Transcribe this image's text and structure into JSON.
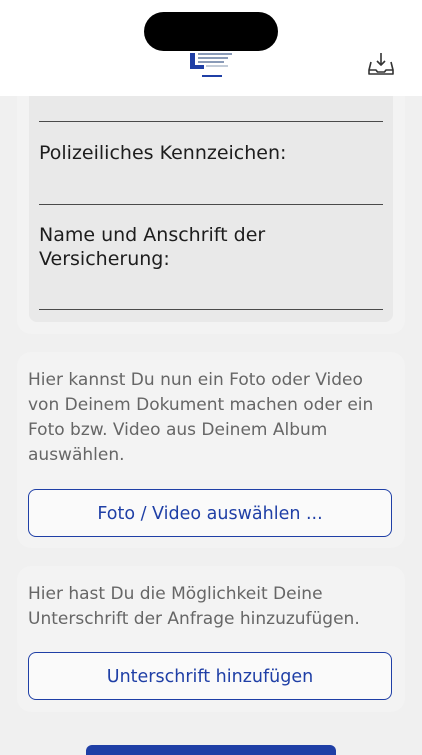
{
  "header": {
    "logo_icon": "company-logo",
    "inbox_icon": "inbox-download-icon"
  },
  "form": {
    "plate_label": "Polizeiliches Kennzeichen:",
    "insurance_label": "Name und Anschrift der Versicherung:"
  },
  "media": {
    "description": "Hier kannst Du nun ein Foto oder Video von Deinem Dokument machen oder ein Foto bzw. Video aus Deinem Album auswählen.",
    "button_label": "Foto / Video auswählen ..."
  },
  "signature": {
    "description": "Hier hast Du die Möglichkeit Deine Unterschrift der Anfrage hinzuzufügen.",
    "button_label": "Unterschrift hinzufügen"
  },
  "colors": {
    "accent": "#1f3fa6",
    "background": "#f0f0f0"
  }
}
